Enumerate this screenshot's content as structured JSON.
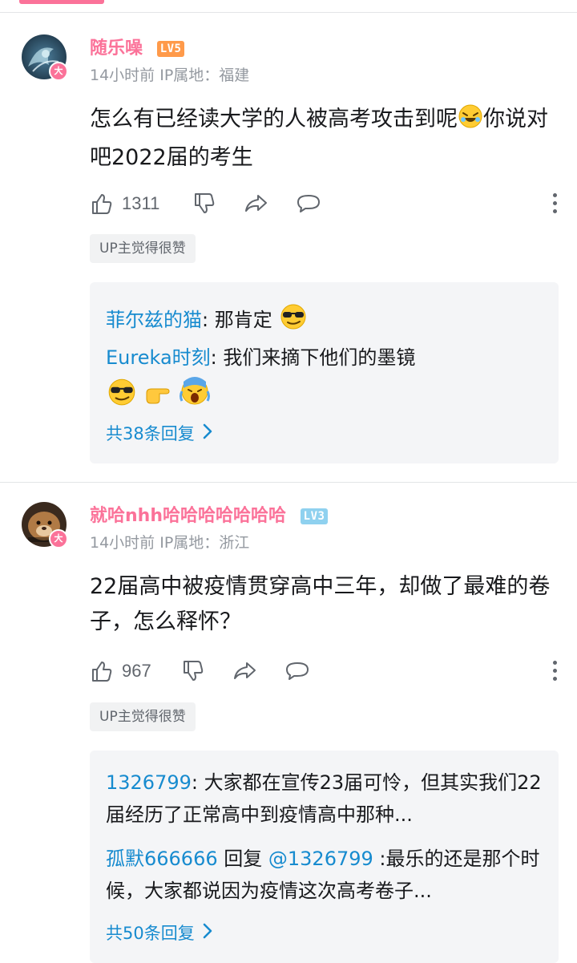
{
  "colors": {
    "brand_pink": "#fb7299",
    "link_blue": "#178bcf",
    "meta_gray": "#9499a0",
    "lv5": "#ff9a4a",
    "lv3": "#8fd1ef"
  },
  "comments": [
    {
      "username": "随乐噪",
      "level": "LV5",
      "avatar_badge": "大",
      "meta": "14小时前  IP属地：福建",
      "content_part1": "怎么有已经读大学的人被高考攻击到呢",
      "content_emoji": "rolling-on-floor-laughing-emoji",
      "content_part2": "你说对吧2022届的考生",
      "likes": "1311",
      "up_tag": "UP主觉得很赞",
      "replies": [
        {
          "user": "菲尔兹的猫",
          "sep": ": ",
          "text": "那肯定",
          "emojis": [
            "sunglasses-emoji"
          ]
        },
        {
          "user": "Eureka时刻",
          "sep": ": ",
          "text": "我们来摘下他们的墨镜",
          "emojis": [
            "sunglasses-emoji",
            "pointing-right-emoji",
            "screaming-emoji"
          ]
        }
      ],
      "more_replies": "共38条回复"
    },
    {
      "username": "就哈nhh哈哈哈哈哈哈哈",
      "level": "LV3",
      "avatar_badge": "大",
      "meta": "14小时前  IP属地：浙江",
      "content": "22届高中被疫情贯穿高中三年，却做了最难的卷子，怎么释怀？",
      "likes": "967",
      "up_tag": "UP主觉得很赞",
      "replies": [
        {
          "user": "1326799",
          "sep": ": ",
          "text": "大家都在宣传23届可怜，但其实我们22届经历了正常高中到疫情高中那种..."
        },
        {
          "user": "孤默666666",
          "mid": " 回复 ",
          "mention": "@1326799",
          "text": " :最乐的还是那个时候，大家都说因为疫情这次高考卷子..."
        }
      ],
      "more_replies": "共50条回复"
    }
  ]
}
